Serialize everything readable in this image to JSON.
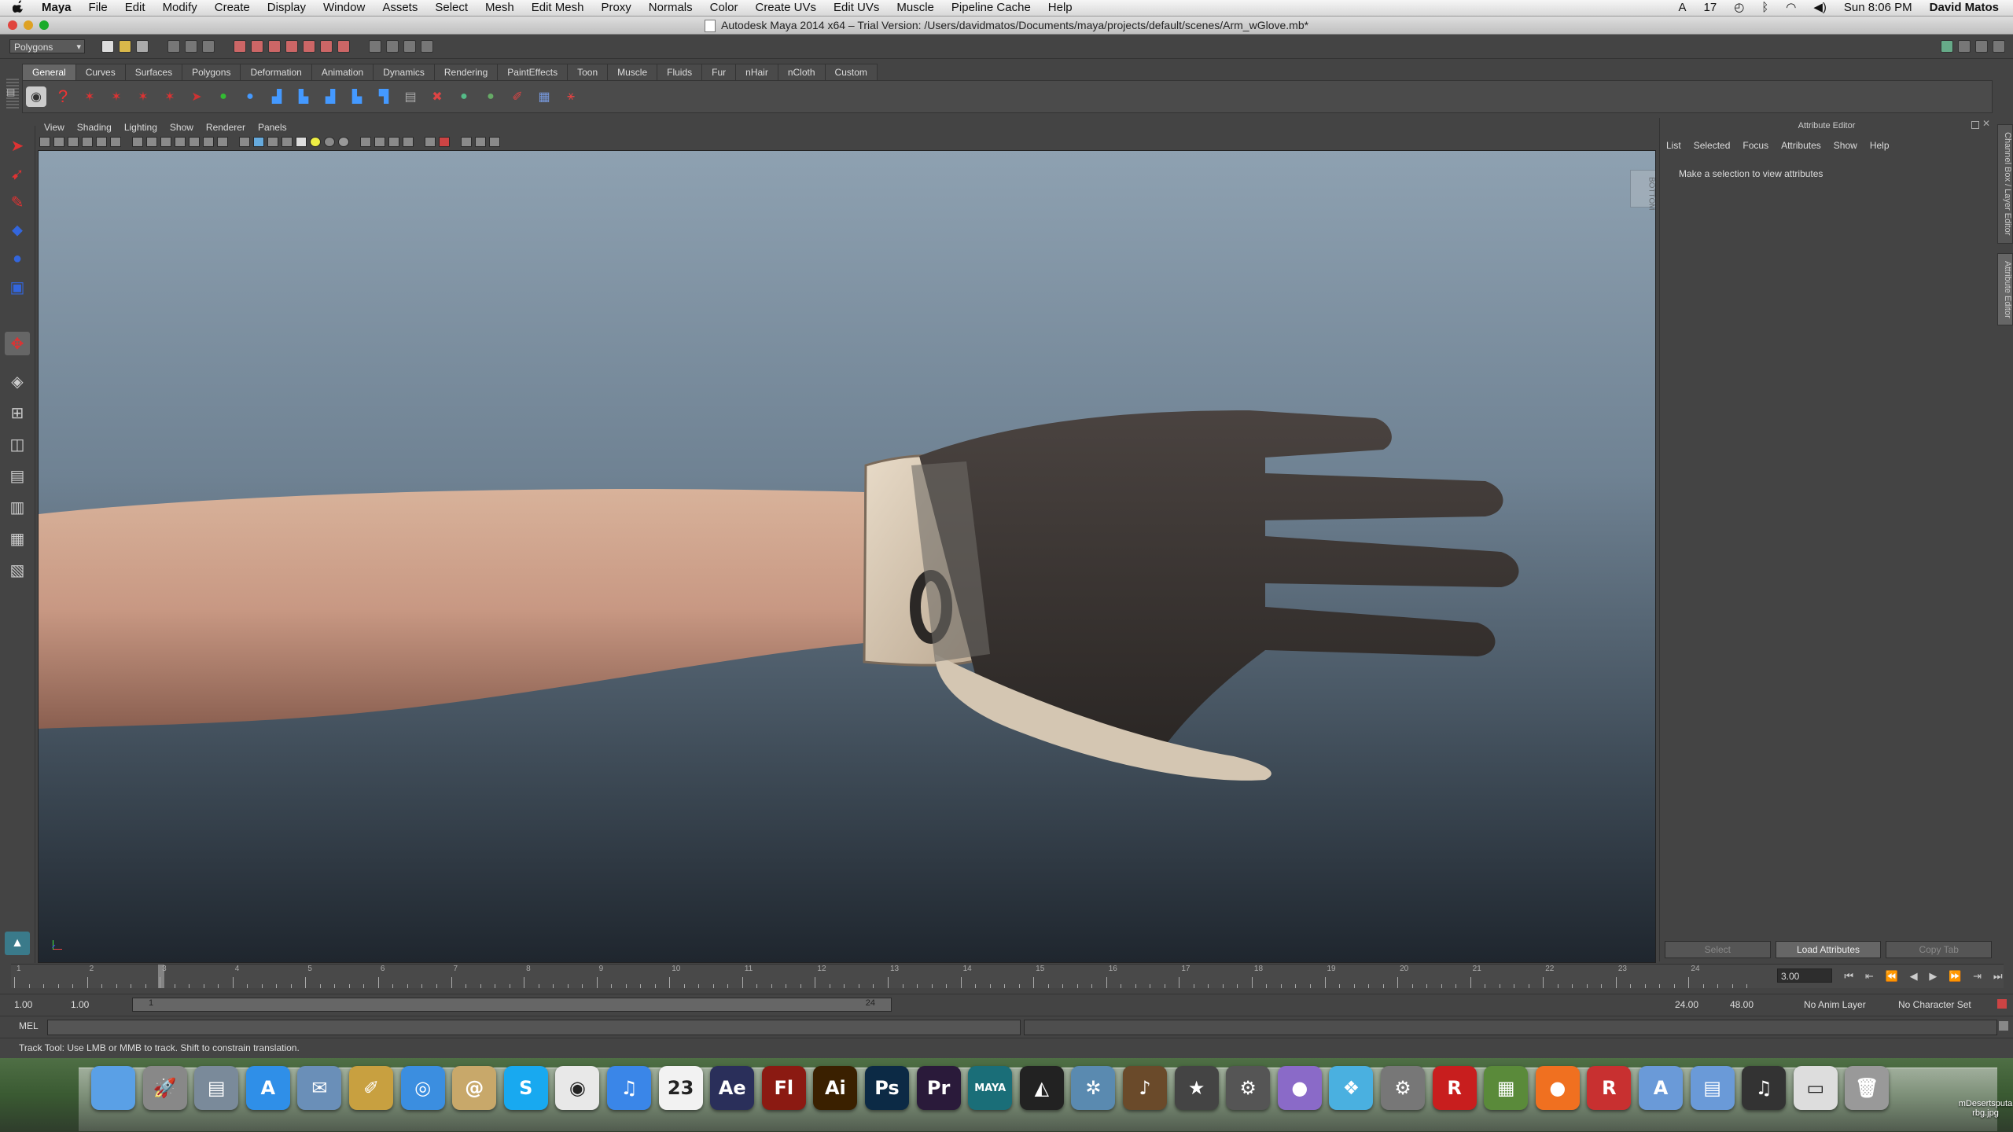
{
  "menubar": {
    "apple": "",
    "app_name": "Maya",
    "items": [
      "File",
      "Edit",
      "Modify",
      "Create",
      "Display",
      "Window",
      "Assets",
      "Select",
      "Mesh",
      "Edit Mesh",
      "Proxy",
      "Normals",
      "Color",
      "Create UVs",
      "Edit UVs",
      "Muscle",
      "Pipeline Cache",
      "Help"
    ],
    "battery_count": "17",
    "clock": "Sun 8:06 PM",
    "user": "David Matos"
  },
  "window": {
    "title": "Autodesk Maya 2014 x64 – Trial Version: /Users/davidmatos/Documents/maya/projects/default/scenes/Arm_wGlove.mb*"
  },
  "statusline": {
    "menuset": "Polygons"
  },
  "shelf": {
    "tabs": [
      "General",
      "Curves",
      "Surfaces",
      "Polygons",
      "Deformation",
      "Animation",
      "Dynamics",
      "Rendering",
      "PaintEffects",
      "Toon",
      "Muscle",
      "Fluids",
      "Fur",
      "nHair",
      "nCloth",
      "Custom"
    ],
    "active_tab": "General"
  },
  "panel": {
    "menu": [
      "View",
      "Shading",
      "Lighting",
      "Show",
      "Renderer",
      "Panels"
    ],
    "viewcube_label": "BOTTOM"
  },
  "attribute_editor": {
    "title": "Attribute Editor",
    "menu": [
      "List",
      "Selected",
      "Focus",
      "Attributes",
      "Show",
      "Help"
    ],
    "message": "Make a selection to view attributes",
    "buttons": {
      "select": "Select",
      "load": "Load Attributes",
      "copy": "Copy Tab"
    },
    "side_tabs": [
      "Channel Box / Layer Editor",
      "Attribute Editor"
    ]
  },
  "timeslider": {
    "ticks": [
      "1",
      "2",
      "3",
      "4",
      "5",
      "6",
      "7",
      "8",
      "9",
      "10",
      "11",
      "12",
      "13",
      "14",
      "15",
      "16",
      "17",
      "18",
      "19",
      "20",
      "21",
      "22",
      "23",
      "24"
    ],
    "current_frame": "3.00"
  },
  "range": {
    "start": "1.00",
    "anim_start": "1.00",
    "slider_start": "1",
    "slider_end": "24",
    "anim_end": "24.00",
    "end": "48.00",
    "anim_layer": "No Anim Layer",
    "character_set": "No Character Set"
  },
  "commandline": {
    "label": "MEL"
  },
  "helpline": {
    "text": "Track Tool: Use LMB or MMB to track. Shift to constrain translation."
  },
  "dock": {
    "icons": [
      "finder",
      "launchpad",
      "preview",
      "app-store",
      "mail",
      "directory-utility",
      "safari",
      "contacts",
      "skype",
      "chrome",
      "itunes",
      "calendar",
      "after-effects",
      "flash",
      "illustrator",
      "photoshop",
      "premiere",
      "maya",
      "unity",
      "maya-sub",
      "garageband",
      "imovie",
      "steam",
      "sphere-app",
      "cube-app",
      "system-preferences",
      "roblox",
      "minecraft",
      "origin",
      "roblox-studio",
      "applications",
      "documents",
      "music",
      "notes",
      "trash"
    ],
    "labels": {
      "after_effects": "Ae",
      "flash": "Fl",
      "illustrator": "Ai",
      "photoshop": "Ps",
      "premiere": "Pr",
      "maya": "MAYA",
      "skype": "S",
      "roblox": "R",
      "calendar": "23",
      "calendar_month": "JUN",
      "stack_label": "mDesertsputa\nrbg.jpg"
    }
  },
  "colors": {
    "maya_bg": "#444444",
    "viewport_top": "#8ea1b1",
    "viewport_bottom": "#1f262e",
    "accent_tab": "#666666"
  }
}
